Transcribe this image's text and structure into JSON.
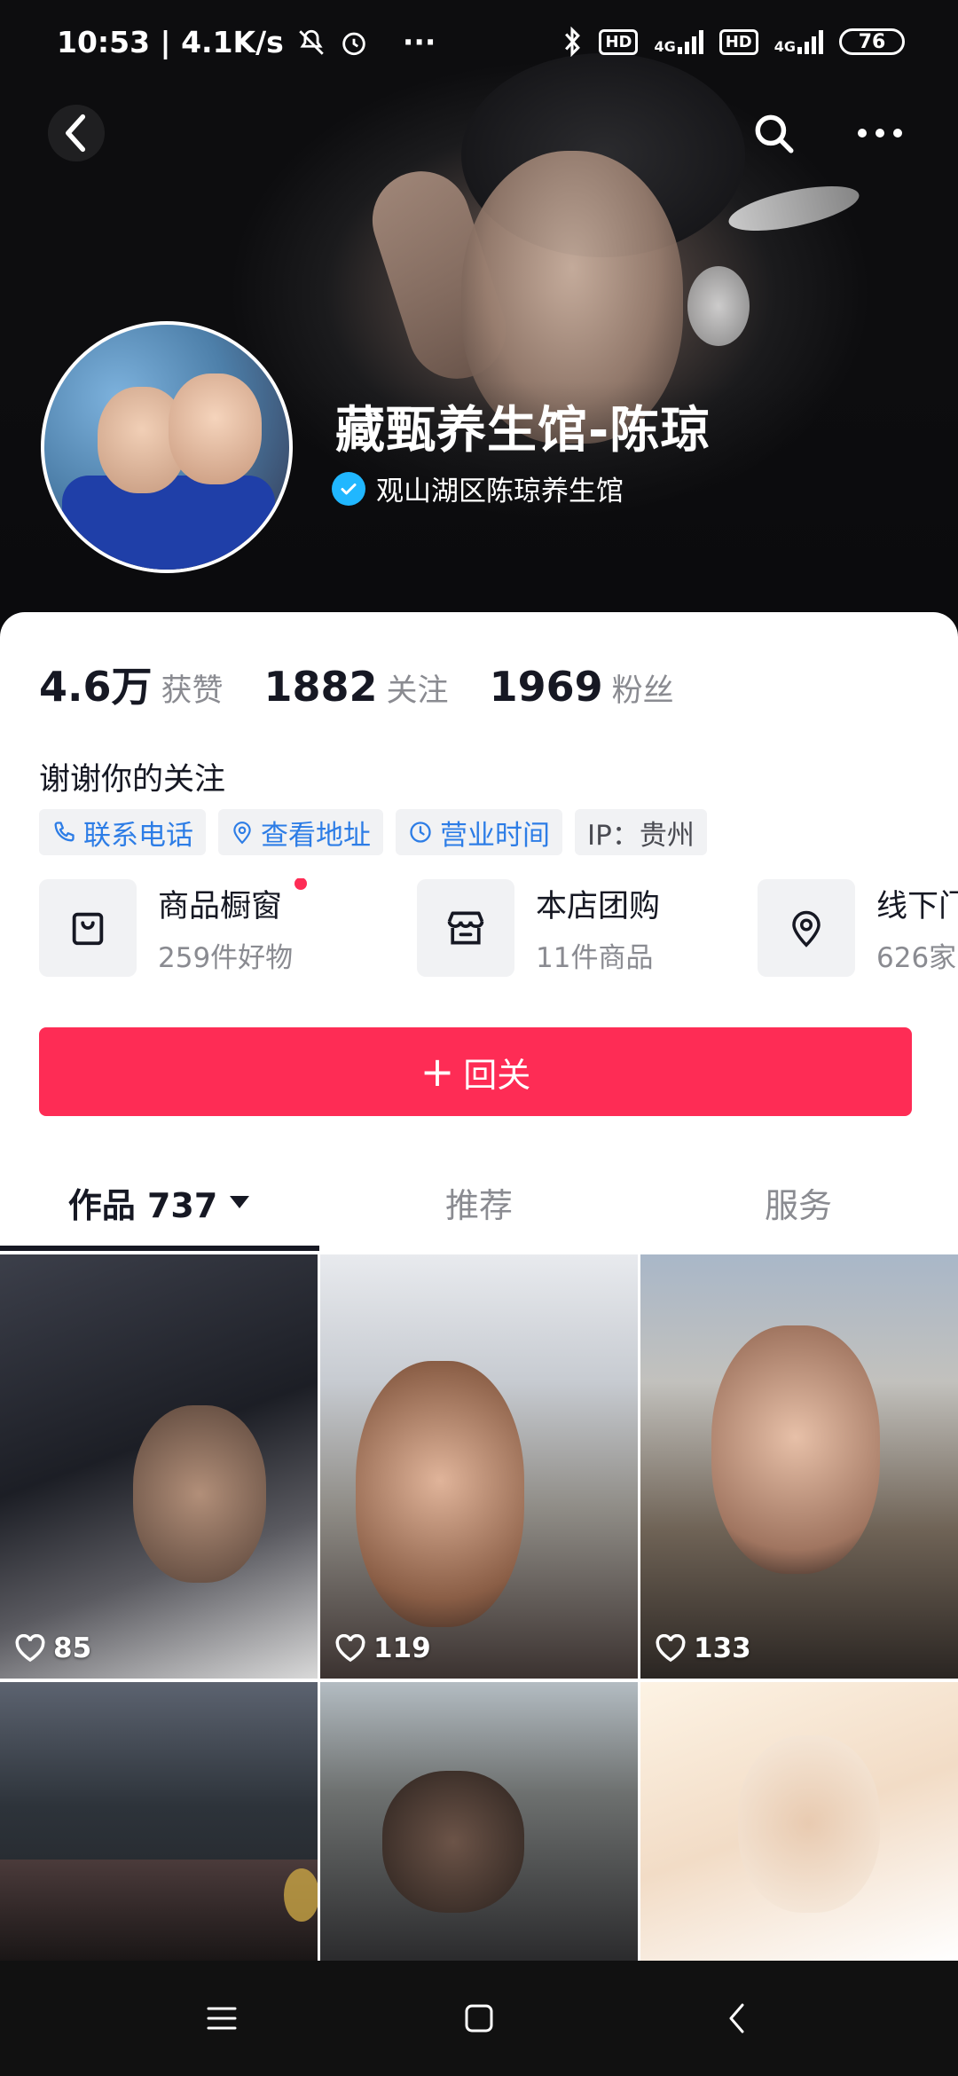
{
  "status_bar": {
    "time_network": "10:53 | 4.1K/s",
    "more": "···",
    "net1": "4G",
    "net2": "4G",
    "hd": "HD",
    "battery": "76"
  },
  "profile": {
    "name": "藏甄养生馆-陈琼",
    "verified_label": "观山湖区陈琼养生馆",
    "stats": [
      {
        "value": "4.6万",
        "label": "获赞"
      },
      {
        "value": "1882",
        "label": "关注"
      },
      {
        "value": "1969",
        "label": "粉丝"
      }
    ],
    "bio": "谢谢你的关注",
    "tags": {
      "phone": "联系电话",
      "address": "查看地址",
      "hours": "营业时间",
      "ip": "IP：贵州"
    }
  },
  "services": [
    {
      "title": "商品橱窗",
      "sub": "259件好物",
      "icon": "bag-icon"
    },
    {
      "title": "本店团购",
      "sub": "11件商品",
      "icon": "store-icon"
    },
    {
      "title": "线下门店",
      "sub": "626家",
      "icon": "location-pin-icon"
    }
  ],
  "follow_button": {
    "label": "回关",
    "icon": "+"
  },
  "tabs": [
    {
      "label": "作品 737"
    },
    {
      "label": "推荐"
    },
    {
      "label": "服务"
    }
  ],
  "videos": [
    {
      "likes": "85"
    },
    {
      "likes": "119"
    },
    {
      "likes": "133"
    },
    {
      "likes": ""
    },
    {
      "likes": ""
    },
    {
      "likes": ""
    }
  ],
  "colors": {
    "accent": "#fe2c55",
    "link_blue": "#2d7de6",
    "verify_blue": "#20b7ff"
  }
}
